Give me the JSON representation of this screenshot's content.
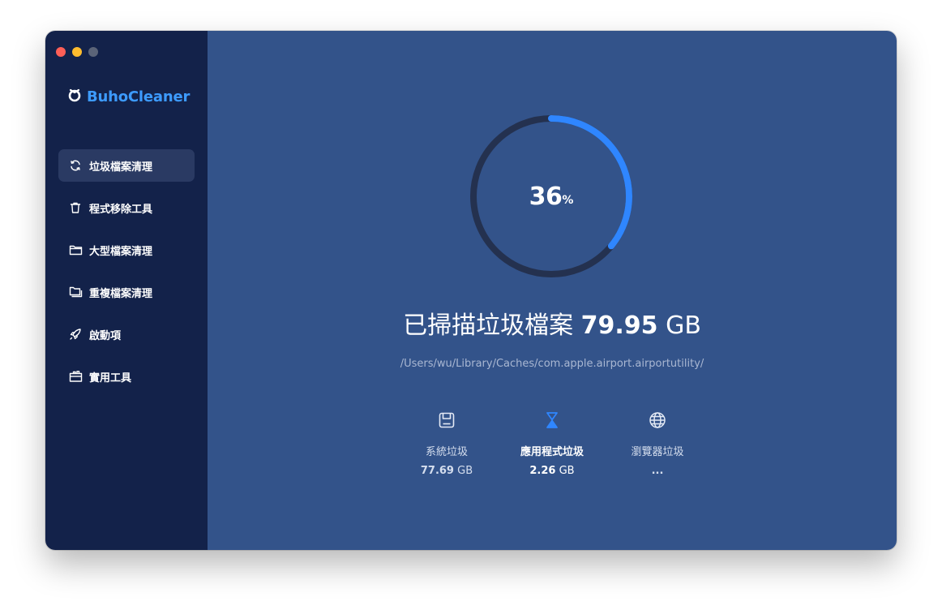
{
  "app": {
    "name": "BuhoCleaner"
  },
  "sidebar": {
    "items": [
      {
        "label": "垃圾檔案清理",
        "icon": "refresh-icon",
        "active": true
      },
      {
        "label": "程式移除工具",
        "icon": "trash-icon",
        "active": false
      },
      {
        "label": "大型檔案清理",
        "icon": "folder-icon",
        "active": false
      },
      {
        "label": "重複檔案清理",
        "icon": "duplicate-folder-icon",
        "active": false
      },
      {
        "label": "啟動項",
        "icon": "rocket-icon",
        "active": false
      },
      {
        "label": "實用工具",
        "icon": "toolbox-icon",
        "active": false
      }
    ]
  },
  "scan": {
    "progress_value": "36",
    "progress_unit": "%",
    "progress_fraction": 0.36,
    "headline_prefix": "已掃描垃圾檔案",
    "headline_size": "79.95",
    "headline_unit": "GB",
    "current_path": "/Users/wu/Library/Caches/com.apple.airport.airportutility/"
  },
  "stats": [
    {
      "label": "系統垃圾",
      "value": "77.69",
      "unit": "GB",
      "icon": "disk-icon",
      "active": false
    },
    {
      "label": "應用程式垃圾",
      "value": "2.26",
      "unit": "GB",
      "icon": "hourglass-icon",
      "active": true
    },
    {
      "label": "瀏覽器垃圾",
      "value": "...",
      "unit": "",
      "icon": "globe-icon",
      "active": false
    }
  ],
  "colors": {
    "sidebar_bg": "#13224a",
    "main_bg": "#33538a",
    "accent": "#2f86ff",
    "brand": "#3d9bff",
    "ring_track": "#24314f"
  }
}
